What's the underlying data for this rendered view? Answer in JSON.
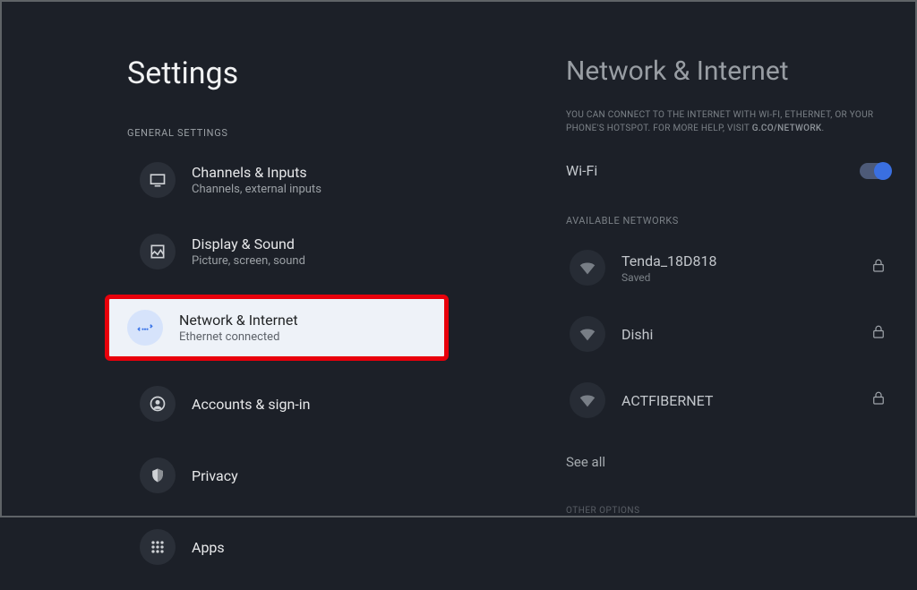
{
  "left": {
    "title": "Settings",
    "section": "GENERAL SETTINGS",
    "items": [
      {
        "title": "Channels & Inputs",
        "sub": "Channels, external inputs",
        "icon": "tv"
      },
      {
        "title": "Display & Sound",
        "sub": "Picture, screen, sound",
        "icon": "image"
      },
      {
        "title": "Network & Internet",
        "sub": "Ethernet connected",
        "icon": "network",
        "selected": true
      },
      {
        "title": "Accounts & sign-in",
        "sub": "",
        "icon": "account"
      },
      {
        "title": "Privacy",
        "sub": "",
        "icon": "privacy"
      },
      {
        "title": "Apps",
        "sub": "",
        "icon": "apps"
      }
    ]
  },
  "right": {
    "title": "Network & Internet",
    "desc_a": "YOU CAN CONNECT TO THE INTERNET WITH WI-FI, ETHERNET, OR YOUR PHONE'S HOTSPOT. FOR MORE HELP, VISIT ",
    "desc_link": "G.CO/NETWORK",
    "desc_b": ".",
    "wifi_label": "Wi-Fi",
    "wifi_on": true,
    "available_label": "AVAILABLE NETWORKS",
    "networks": [
      {
        "name": "Tenda_18D818",
        "sub": "Saved",
        "locked": true
      },
      {
        "name": "Dishi",
        "sub": "",
        "locked": true
      },
      {
        "name": "ACTFIBERNET",
        "sub": "",
        "locked": true
      }
    ],
    "see_all": "See all",
    "other_options": "OTHER OPTIONS"
  }
}
